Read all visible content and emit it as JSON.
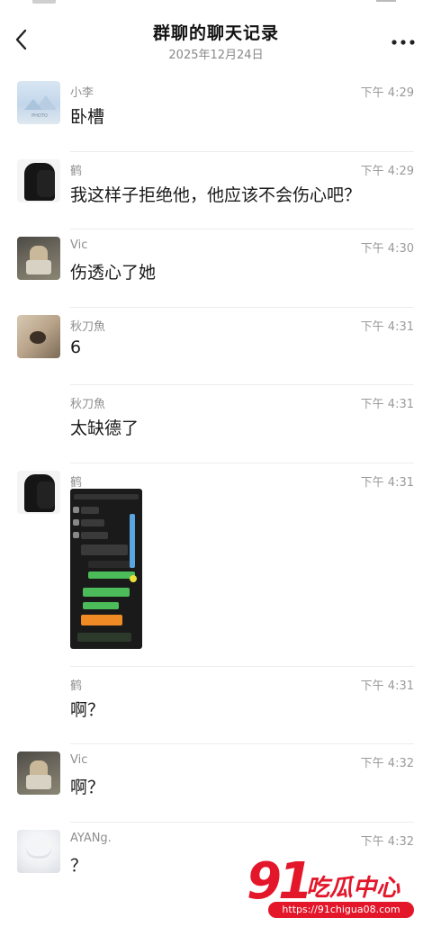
{
  "header": {
    "title": "群聊的聊天记录",
    "subtitle": "2025年12月24日",
    "back_icon": "chevron-left-icon",
    "more_icon": "more-horizontal-icon"
  },
  "messages": [
    {
      "name": "小李",
      "time": "下午 4:29",
      "text": "卧槽",
      "avatar": "landscape-image-avatar"
    },
    {
      "name": "鹤",
      "time": "下午 4:29",
      "text": "我这样子拒绝他，他应该不会伤心吧？",
      "avatar": "dark-figure-avatar"
    },
    {
      "name": "Vic",
      "time": "下午 4:30",
      "text": "伤透心了她",
      "avatar": "photo-avatar"
    },
    {
      "name": "秋刀魚",
      "time": "下午 4:31",
      "text": "6",
      "avatar": "cat-avatar"
    },
    {
      "name": "秋刀魚",
      "time": "下午 4:31",
      "text": "太缺德了",
      "avatar": ""
    },
    {
      "name": "鹤",
      "time": "下午 4:31",
      "text": "",
      "avatar": "dark-figure-avatar",
      "attachment": "chat-screenshot-image"
    },
    {
      "name": "鹤",
      "time": "下午 4:31",
      "text": "啊？",
      "avatar": ""
    },
    {
      "name": "Vic",
      "time": "下午 4:32",
      "text": "啊？",
      "avatar": "photo-avatar"
    },
    {
      "name": "AYANg.",
      "time": "下午 4:32",
      "text": "？",
      "avatar": "white-hair-avatar"
    }
  ],
  "watermark": {
    "number": "91",
    "brand": "吃瓜中心",
    "url": "https://91chigua08.com"
  },
  "colors": {
    "accent_watermark": "#e3162a",
    "name_gray": "#8f8f8f",
    "divider": "#ececec"
  }
}
